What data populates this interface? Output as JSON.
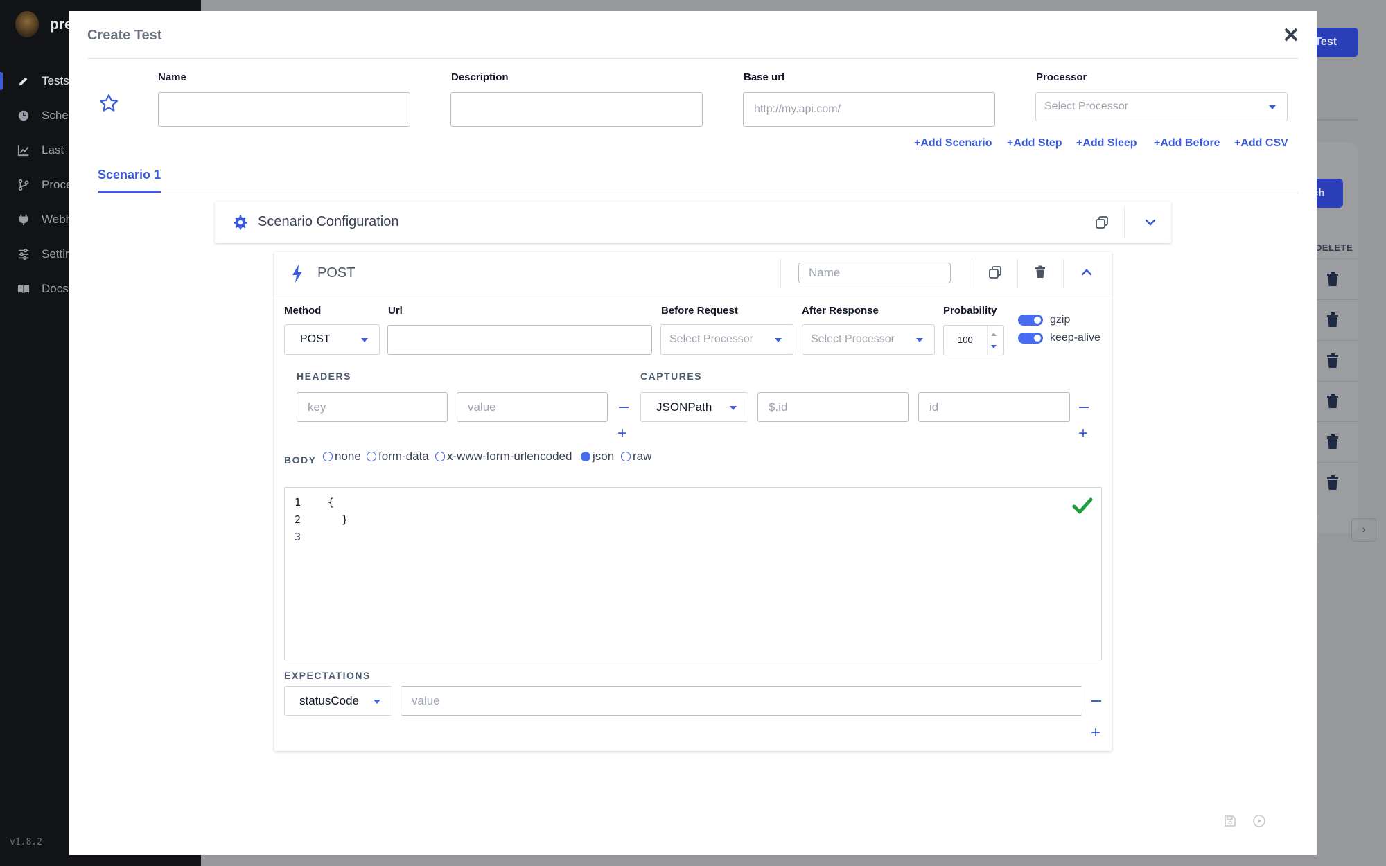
{
  "app": {
    "brand": "pre",
    "version": "v1.8.2",
    "nav": [
      {
        "label": "Tests",
        "icon": "pencil-icon"
      },
      {
        "label": "Sche",
        "icon": "clock-icon"
      },
      {
        "label": "Last",
        "icon": "chart-line-icon"
      },
      {
        "label": "Proce",
        "icon": "branch-icon"
      },
      {
        "label": "Webh",
        "icon": "plug-icon"
      },
      {
        "label": "Settir",
        "icon": "sliders-icon"
      },
      {
        "label": "Docs",
        "icon": "book-icon"
      }
    ],
    "background": {
      "create_button": "e Test",
      "search_button": "ch",
      "delete_header": "DELETE",
      "pager_next": "›"
    }
  },
  "modal": {
    "title": "Create Test",
    "close": "✕",
    "fields": {
      "name_label": "Name",
      "description_label": "Description",
      "base_url_label": "Base url",
      "base_url_placeholder": "http://my.api.com/",
      "processor_label": "Processor",
      "processor_placeholder": "Select Processor"
    },
    "add_links": [
      "+Add Scenario",
      "+Add Step",
      "+Add Sleep",
      "+Add Before",
      "+Add CSV"
    ],
    "tabs": [
      "Scenario 1"
    ],
    "scenario_config": {
      "title": "Scenario Configuration"
    },
    "step": {
      "method_display": "POST",
      "name_placeholder": "Name",
      "labels": {
        "method": "Method",
        "url": "Url",
        "before_request": "Before Request",
        "after_response": "After Response",
        "probability": "Probability"
      },
      "method_value": "POST",
      "before_placeholder": "Select Processor",
      "after_placeholder": "Select Processor",
      "probability_value": "100",
      "toggles": [
        {
          "label": "gzip",
          "on": true
        },
        {
          "label": "keep-alive",
          "on": true
        }
      ],
      "headers": {
        "title": "HEADERS",
        "key_placeholder": "key",
        "value_placeholder": "value"
      },
      "captures": {
        "title": "CAPTURES",
        "type_value": "JSONPath",
        "path_placeholder": "$.id",
        "name_placeholder": "id"
      },
      "body": {
        "title": "BODY",
        "options": [
          "none",
          "form-data",
          "x-www-form-urlencoded",
          "json",
          "raw"
        ],
        "selected": "json",
        "lines": [
          {
            "no": "1",
            "code": "{"
          },
          {
            "no": "2",
            "code": "}"
          },
          {
            "no": "3",
            "code": ""
          }
        ]
      },
      "expectations": {
        "title": "EXPECTATIONS",
        "type_value": "statusCode",
        "value_placeholder": "value"
      }
    }
  },
  "colors": {
    "accent": "#3b5bdb",
    "toggle_on": "#4a6cf0",
    "valid_check": "#1f9d3a"
  }
}
